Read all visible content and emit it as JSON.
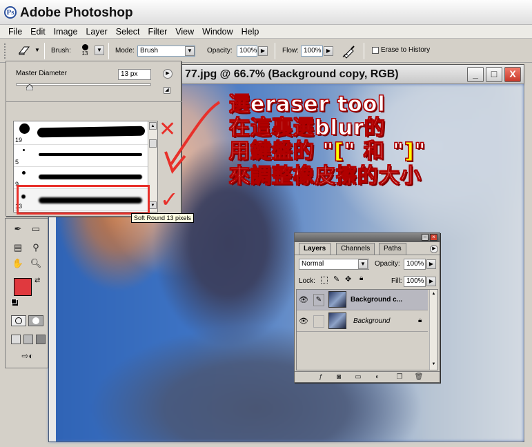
{
  "window": {
    "title": "Adobe Photoshop",
    "icon": "photoshop-app-icon"
  },
  "menu": [
    "File",
    "Edit",
    "Image",
    "Layer",
    "Select",
    "Filter",
    "View",
    "Window",
    "Help"
  ],
  "options_bar": {
    "brush_label": "Brush:",
    "brush_size": "13",
    "mode_label": "Mode:",
    "mode_value": "Brush",
    "opacity_label": "Opacity:",
    "opacity_value": "100%",
    "flow_label": "Flow:",
    "flow_value": "100%",
    "erase_history_label": "Erase to History",
    "erase_history_checked": false
  },
  "brush_picker": {
    "master_diameter_label": "Master Diameter",
    "master_diameter_value": "13 px",
    "slider_fraction": 0.1,
    "brushes": [
      {
        "size": "19"
      },
      {
        "size": "5"
      },
      {
        "size": "9"
      },
      {
        "size": "13"
      }
    ],
    "tooltip": "Soft Round 13 pixels"
  },
  "document": {
    "title": "77.jpg @ 66.7% (Background copy, RGB)",
    "minimize": "_",
    "maximize": "□",
    "close": "X"
  },
  "annotations": {
    "lines": [
      "選eraser tool",
      "在這裏選blur的",
      "用鍵盤的 \"",
      "[",
      "\" 和 \"",
      "]",
      "\"",
      "來調整橡皮擦的大小"
    ],
    "cross_mark": "✕",
    "check_mark": "✓",
    "colors": {
      "text_fill": "#ffffff",
      "text_outline": "#b00000",
      "bracket": "#ffff00",
      "arrow": "#e8302a"
    }
  },
  "layers_panel": {
    "tabs": [
      "Layers",
      "Channels",
      "Paths"
    ],
    "active_tab": "Layers",
    "blend_mode": "Normal",
    "opacity_label": "Opacity:",
    "opacity_value": "100%",
    "lock_label": "Lock:",
    "fill_label": "Fill:",
    "fill_value": "100%",
    "layers": [
      {
        "name": "Background c...",
        "selected": true,
        "locked": false
      },
      {
        "name": "Background",
        "selected": false,
        "locked": true
      }
    ]
  },
  "colors": {
    "foreground": "#e0393e",
    "background": "#ffffff",
    "accent_close": "#c8382a"
  }
}
